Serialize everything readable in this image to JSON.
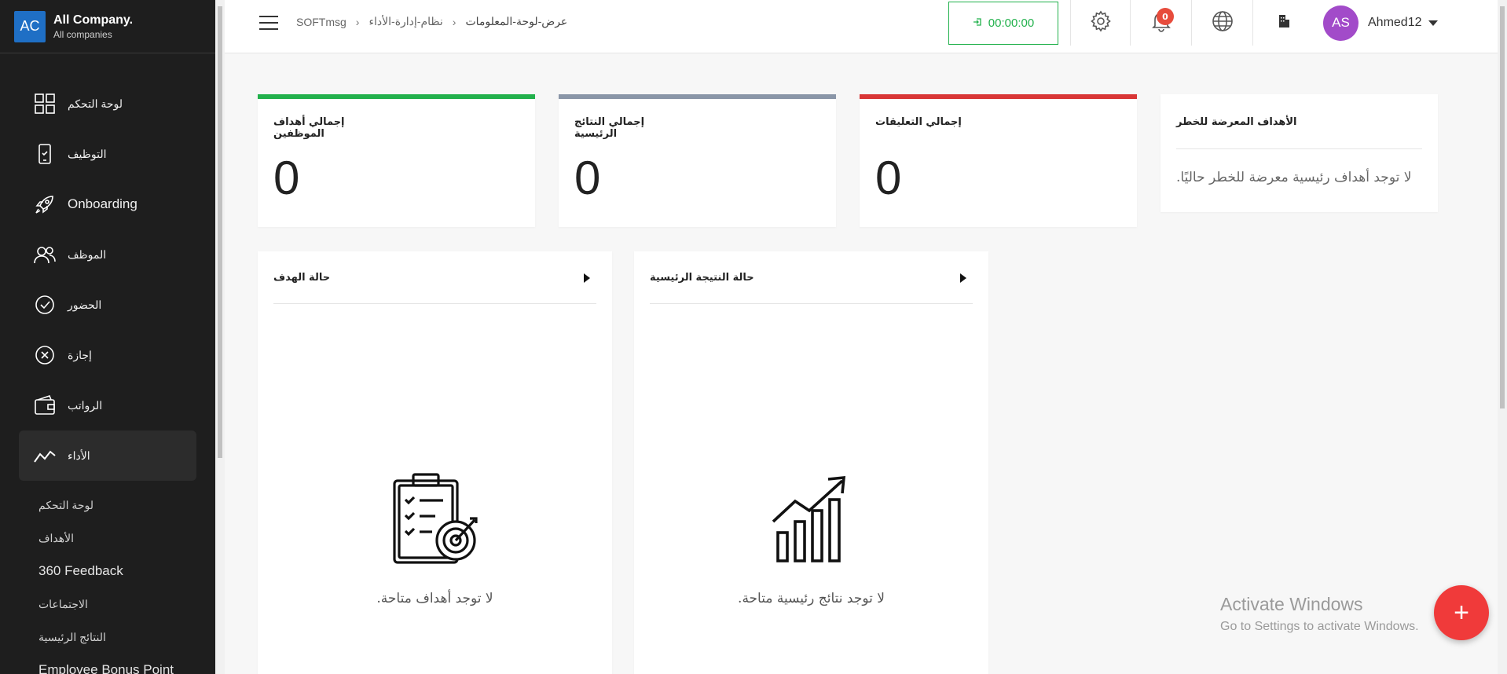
{
  "company": {
    "logo": "AC",
    "name": "All Company.",
    "sub": "All companies"
  },
  "sidebar": {
    "items": [
      {
        "label": "لوحة التحكم",
        "icon": "grid-icon"
      },
      {
        "label": "التوظيف",
        "icon": "phone-icon"
      },
      {
        "label": "Onboarding",
        "icon": "rocket-icon"
      },
      {
        "label": "الموظف",
        "icon": "users-icon"
      },
      {
        "label": "الحضور",
        "icon": "check-circle-icon"
      },
      {
        "label": "إجازة",
        "icon": "x-circle-icon"
      },
      {
        "label": "الرواتب",
        "icon": "wallet-icon"
      },
      {
        "label": "الأداء",
        "icon": "trend-icon"
      }
    ],
    "sub_items": [
      {
        "label": "لوحة التحكم"
      },
      {
        "label": "الأهداف"
      },
      {
        "label": "360 Feedback"
      },
      {
        "label": "الاجتماعات"
      },
      {
        "label": "النتائج الرئيسية"
      },
      {
        "label": "Employee Bonus Point"
      }
    ]
  },
  "header": {
    "breadcrumb": [
      "SOFTmsg",
      "نظام-إدارة-الأداء",
      "عرض-لوحة-المعلومات"
    ],
    "timer": "00:00:00",
    "notifications_count": "0",
    "user": {
      "initials": "AS",
      "name": "Ahmed12"
    }
  },
  "colors": {
    "accent_green": "#22b14c",
    "bar_gray": "#8a96a8",
    "bar_red": "#d93636",
    "fab_red": "#f03a3a",
    "avatar": "#a24bc9"
  },
  "stats": [
    {
      "title": "إجمالي أهداف الموظفين",
      "value": "0"
    },
    {
      "title": "إجمالي النتائج الرئيسية",
      "value": "0"
    },
    {
      "title": "إجمالي التعليقات",
      "value": "0"
    }
  ],
  "risk": {
    "title": "الأهداف المعرضة للخطر",
    "message": ".لا توجد أهداف رئيسية معرضة للخطر حاليًا"
  },
  "panels": [
    {
      "title": "حالة الهدف",
      "empty": ".لا توجد أهداف متاحة",
      "icon": "clipboard-target-icon"
    },
    {
      "title": "حالة النتيجة الرئيسية",
      "empty": ".لا توجد نتائج رئيسية متاحة",
      "icon": "growth-chart-icon"
    }
  ],
  "watermark": {
    "line1": "Activate Windows",
    "line2": "Go to Settings to activate Windows."
  },
  "fab": {
    "label": "+"
  }
}
